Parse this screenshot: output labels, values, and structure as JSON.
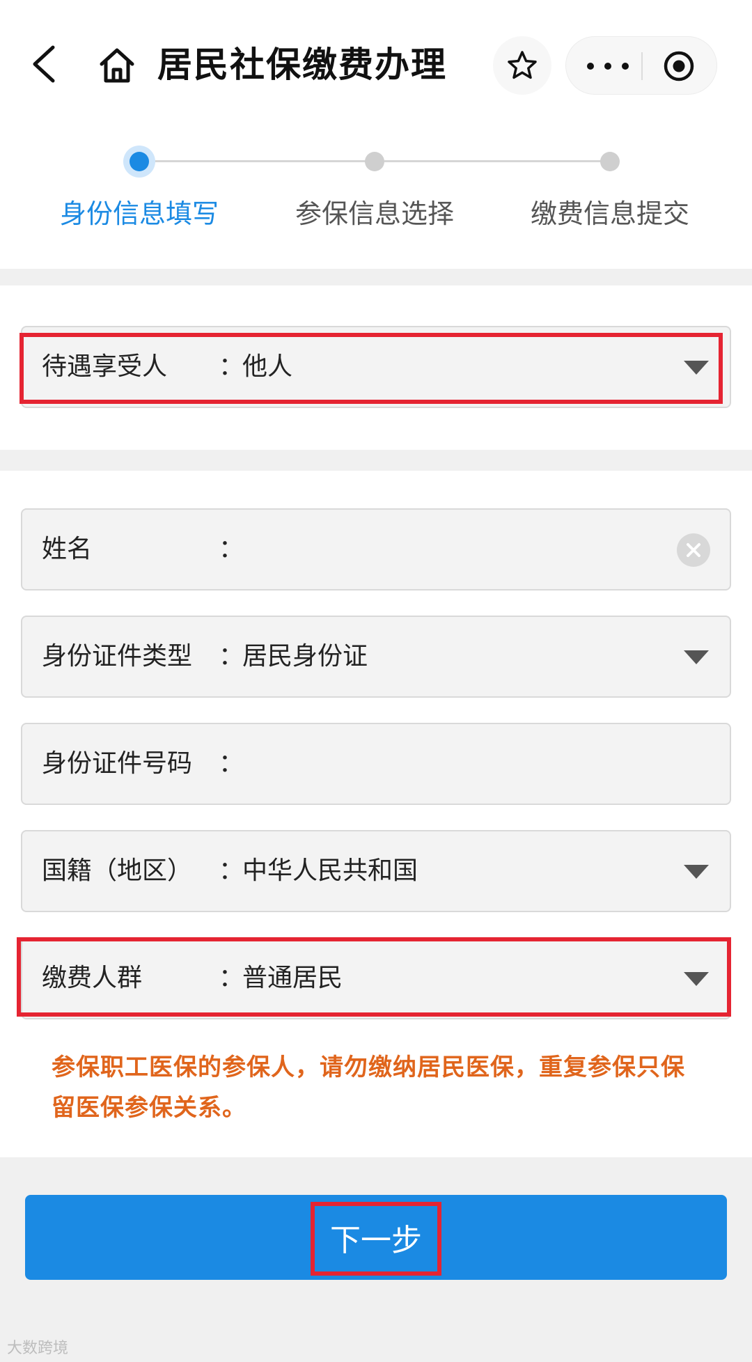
{
  "header": {
    "title": "居民社保缴费办理",
    "icons": [
      "back-icon",
      "home-icon",
      "star-icon",
      "more-icon",
      "target-icon"
    ]
  },
  "steps": [
    {
      "label": "身份信息填写",
      "active": true
    },
    {
      "label": "参保信息选择",
      "active": false
    },
    {
      "label": "缴费信息提交",
      "active": false
    }
  ],
  "form": {
    "beneficiary": {
      "label": "待遇享受人",
      "colon": "：",
      "value": "他人"
    },
    "name": {
      "label": "姓名",
      "colon": "：",
      "value": ""
    },
    "id_type": {
      "label": "身份证件类型",
      "colon": "：",
      "value": "居民身份证"
    },
    "id_number": {
      "label": "身份证件号码",
      "colon": "：",
      "value": ""
    },
    "nationality": {
      "label": "国籍（地区）",
      "colon": "：",
      "value": "中华人民共和国"
    },
    "payer_group": {
      "label": "缴费人群",
      "colon": "：",
      "value": "普通居民"
    }
  },
  "notice": "参保职工医保的参保人，请勿缴纳居民医保，重复参保只保留医保参保关系。",
  "next_button": "下一步",
  "watermark": "大数跨境",
  "colors": {
    "accent": "#1b8ae3",
    "warning": "#e0651c",
    "highlight": "#e52432"
  }
}
